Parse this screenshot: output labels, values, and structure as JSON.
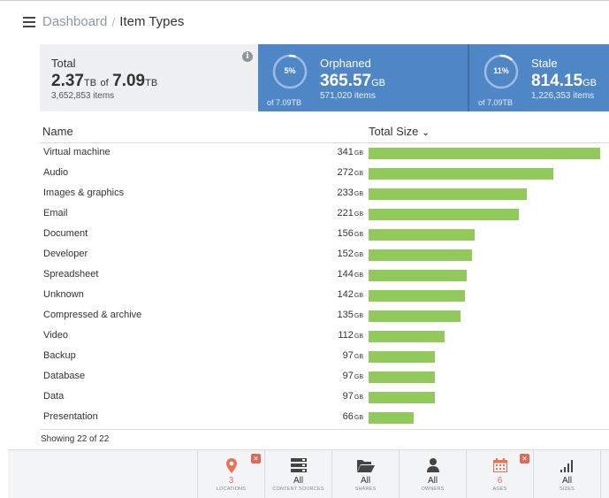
{
  "breadcrumb": {
    "root": "Dashboard",
    "separator": "/",
    "current": "Item Types"
  },
  "summary": {
    "total": {
      "title": "Total",
      "used": "2.37",
      "used_unit": "TB",
      "of_word": "of",
      "capacity": "7.09",
      "capacity_unit": "TB",
      "items": "3,652,853 items"
    },
    "orphaned": {
      "title": "Orphaned",
      "percent": "5%",
      "percent_value": 5,
      "of_text": "of 7.09TB",
      "size": "365.57",
      "size_unit": "GB",
      "items": "571,020 items"
    },
    "stale": {
      "title": "Stale",
      "percent": "11%",
      "percent_value": 11,
      "of_text": "of 7.09TB",
      "size": "814.15",
      "size_unit": "GB",
      "items": "1,226,353 items"
    }
  },
  "table": {
    "col_name": "Name",
    "col_size": "Total Size",
    "max_value": 341,
    "rows": [
      {
        "name": "Virtual machine",
        "size": "341",
        "unit": "GB",
        "value": 341
      },
      {
        "name": "Audio",
        "size": "272",
        "unit": "GB",
        "value": 272
      },
      {
        "name": "Images & graphics",
        "size": "233",
        "unit": "GB",
        "value": 233
      },
      {
        "name": "Email",
        "size": "221",
        "unit": "GB",
        "value": 221
      },
      {
        "name": "Document",
        "size": "156",
        "unit": "GB",
        "value": 156
      },
      {
        "name": "Developer",
        "size": "152",
        "unit": "GB",
        "value": 152
      },
      {
        "name": "Spreadsheet",
        "size": "144",
        "unit": "GB",
        "value": 144
      },
      {
        "name": "Unknown",
        "size": "142",
        "unit": "GB",
        "value": 142
      },
      {
        "name": "Compressed & archive",
        "size": "135",
        "unit": "GB",
        "value": 135
      },
      {
        "name": "Video",
        "size": "112",
        "unit": "GB",
        "value": 112
      },
      {
        "name": "Backup",
        "size": "97",
        "unit": "GB",
        "value": 97
      },
      {
        "name": "Database",
        "size": "97",
        "unit": "GB",
        "value": 97
      },
      {
        "name": "Data",
        "size": "97",
        "unit": "GB",
        "value": 97
      },
      {
        "name": "Presentation",
        "size": "66",
        "unit": "GB",
        "value": 66
      }
    ],
    "footer": "Showing 22 of 22"
  },
  "filters": [
    {
      "icon": "location-pin-icon",
      "value": "3",
      "label": "LOCATIONS",
      "active": true
    },
    {
      "icon": "server-icon",
      "value": "All",
      "label": "CONTENT SOURCES",
      "active": false
    },
    {
      "icon": "folder-open-icon",
      "value": "All",
      "label": "SHARES",
      "active": false
    },
    {
      "icon": "user-icon",
      "value": "All",
      "label": "OWNERS",
      "active": false
    },
    {
      "icon": "calendar-icon",
      "value": "6",
      "label": "AGES",
      "active": true
    },
    {
      "icon": "signal-bars-icon",
      "value": "All",
      "label": "SIZES",
      "active": false
    }
  ],
  "colors": {
    "accent_blue": "#4f86c6",
    "bar_green": "#92c95b",
    "filter_active": "#e8735a",
    "close_badge": "#e06a5a"
  }
}
